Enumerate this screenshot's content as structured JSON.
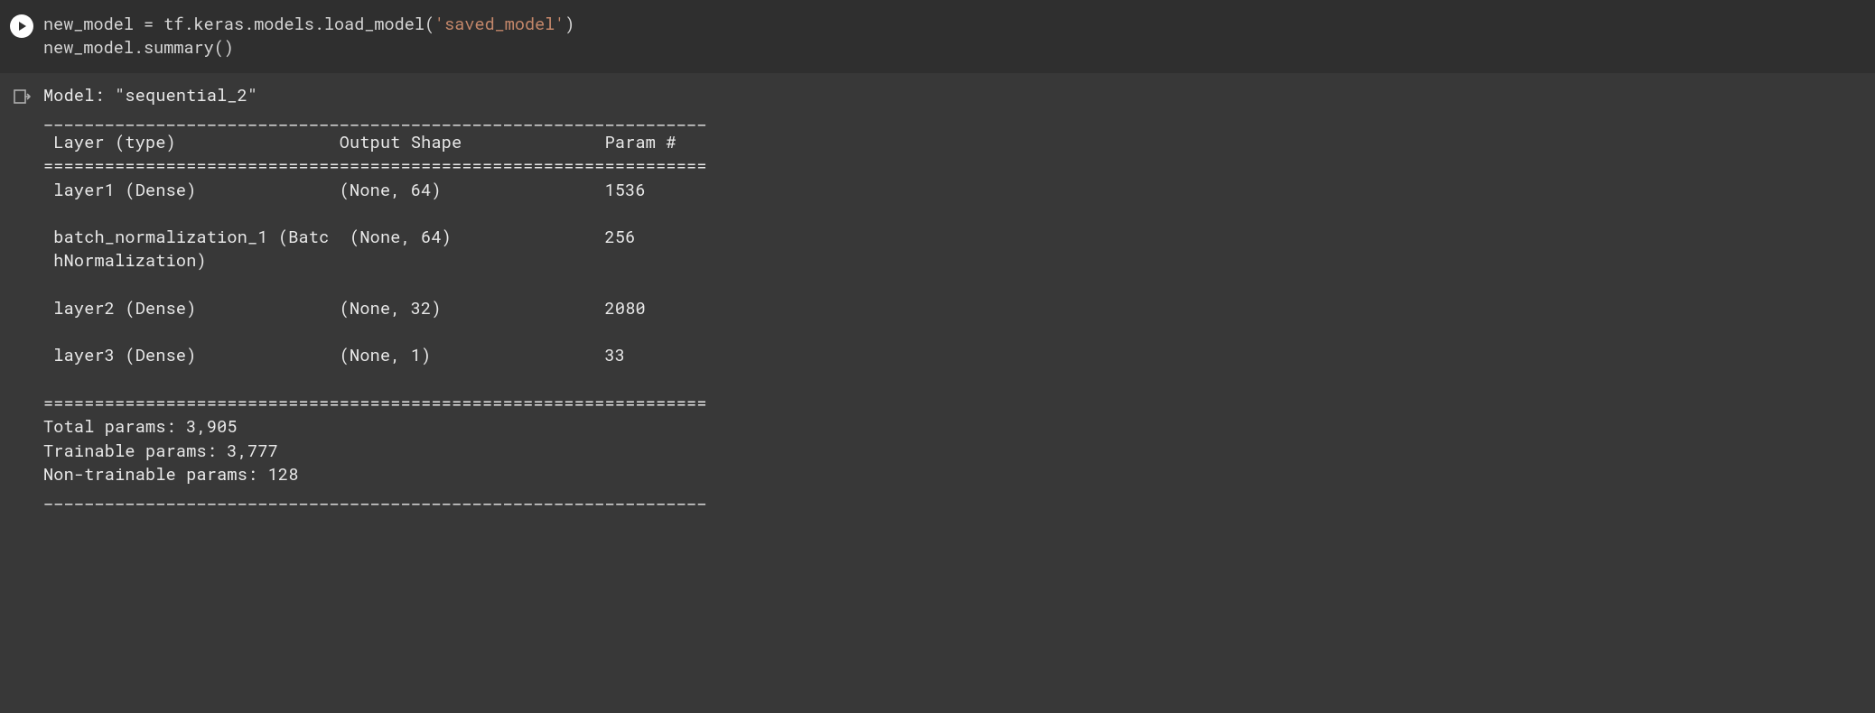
{
  "code": {
    "line1_p1": "new_model ",
    "line1_p2": "=",
    "line1_p3": " tf",
    "line1_p4": ".",
    "line1_p5": "keras",
    "line1_p6": ".",
    "line1_p7": "models",
    "line1_p8": ".",
    "line1_p9": "load_model",
    "line1_p10": "(",
    "line1_p11": "'saved_model'",
    "line1_p12": ")",
    "line2_p1": "new_model",
    "line2_p2": ".",
    "line2_p3": "summary",
    "line2_p4": "()"
  },
  "output": {
    "model_line": "Model: \"sequential_2\"",
    "rule_thin": "_________________________________________________________________",
    "header": " Layer (type)                Output Shape              Param #   ",
    "rule_thick": "=================================================================",
    "row1": " layer1 (Dense)              (None, 64)                1536      ",
    "blank": "                                                                 ",
    "row2a": " batch_normalization_1 (Batc  (None, 64)               256       ",
    "row2b": " hNormalization)                                                 ",
    "row3": " layer2 (Dense)              (None, 32)                2080      ",
    "row4": " layer3 (Dense)              (None, 1)                 33        ",
    "total": "Total params: 3,905",
    "trainable": "Trainable params: 3,777",
    "nontrainable": "Non-trainable params: 128"
  }
}
